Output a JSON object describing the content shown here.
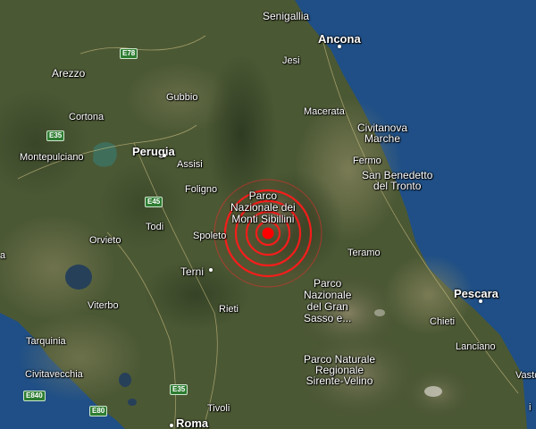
{
  "map": {
    "view": "satellite",
    "colors": {
      "sea": "#1f4f86",
      "land_dark": "#3a4a2a",
      "land_light": "#7f7a5a",
      "epicenter": "#ff0000"
    },
    "labels": {
      "senigallia": "Senigallia",
      "ancona": "Ancona",
      "jesi": "Jesi",
      "arezzo": "Arezzo",
      "gubbio": "Gubbio",
      "cortona": "Cortona",
      "macerata": "Macerata",
      "civitanova": "Civitanova\nMarche",
      "perugia": "Perugia",
      "assisi": "Assisi",
      "montepulciano": "Montepulciano",
      "fermo": "Fermo",
      "san_benedetto": "San Benedetto\ndel Tronto",
      "foligno": "Foligno",
      "sibillini": "Parco\nNazionale dei\nMonti Sibillini",
      "todi": "Todi",
      "orvieto": "Orvieto",
      "spoleto": "Spoleto",
      "teramo": "Teramo",
      "terni": "Terni",
      "gran_sasso": "Parco\nNazionale\ndel Gran\nSasso e...",
      "pescara": "Pescara",
      "viterbo": "Viterbo",
      "rieti": "Rieti",
      "chieti": "Chieti",
      "tarquinia": "Tarquinia",
      "lanciano": "Lanciano",
      "sirente": "Parco Naturale\nRegionale\nSirente-Velino",
      "civitavecchia": "Civitavecchia",
      "vasto": "Vasto",
      "tivoli": "Tivoli",
      "roma": "Roma",
      "edge_a": "a",
      "edge_i": "i"
    },
    "roads": {
      "e78": "E78",
      "e35a": "E35",
      "e45": "E45",
      "e35b": "E35",
      "e840": "E840",
      "e80": "E80"
    }
  }
}
